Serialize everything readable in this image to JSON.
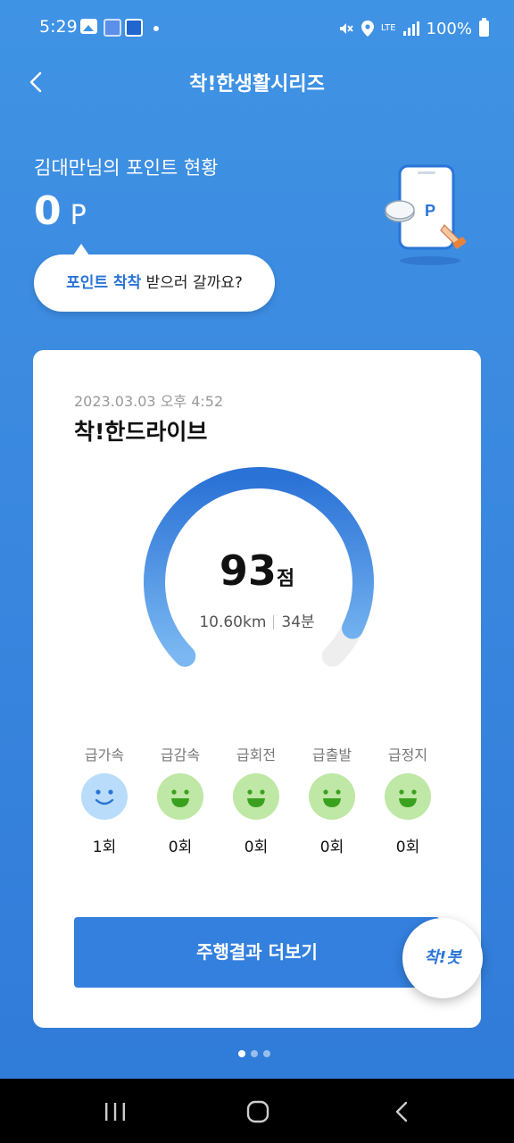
{
  "status_bar": {
    "time": "5:29",
    "lte": "LTE",
    "battery": "100%"
  },
  "header": {
    "title": "착!한생활시리즈"
  },
  "points": {
    "label": "김대만님의 포인트 현황",
    "value": "0",
    "unit": "P",
    "bubble_accent": "포인트 착착",
    "bubble_rest": " 받으러 갈까요?"
  },
  "card": {
    "date": "2023.03.03 오후 4:52",
    "title": "착!한드라이브",
    "score": "93",
    "score_unit": "점",
    "score_fraction": 0.93,
    "distance": "10.60km",
    "duration": "34분",
    "events": [
      {
        "label": "급가속",
        "count": "1회",
        "mood": "neutral"
      },
      {
        "label": "급감속",
        "count": "0회",
        "mood": "happy"
      },
      {
        "label": "급회전",
        "count": "0회",
        "mood": "happy"
      },
      {
        "label": "급출발",
        "count": "0회",
        "mood": "happy"
      },
      {
        "label": "급정지",
        "count": "0회",
        "mood": "happy"
      }
    ],
    "more_button": "주행결과 더보기"
  },
  "bot_button": "착!봇",
  "pager": {
    "count": 3,
    "active": 1
  },
  "colors": {
    "background": "#3b8ae0",
    "accent": "#3380df",
    "face_neutral": "#b9dcfa",
    "face_happy": "#bfe7a5"
  }
}
